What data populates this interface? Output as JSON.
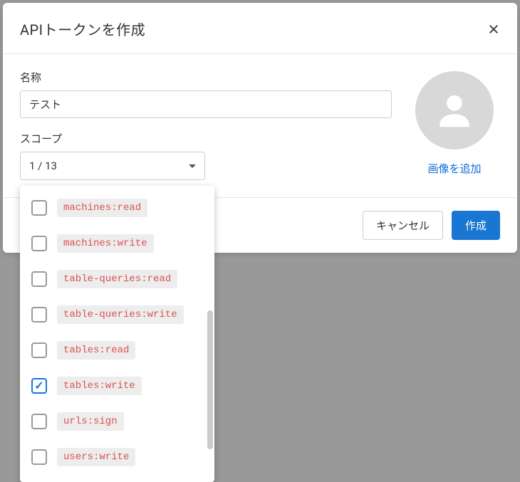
{
  "modal": {
    "title": "APIトークンを作成",
    "name_label": "名称",
    "name_value": "テスト",
    "scope_label": "スコープ",
    "scope_summary": "1 / 13",
    "add_image_label": "画像を追加",
    "cancel_label": "キャンセル",
    "create_label": "作成"
  },
  "scopes": [
    {
      "label": "machines:read",
      "checked": false
    },
    {
      "label": "machines:write",
      "checked": false
    },
    {
      "label": "table-queries:read",
      "checked": false
    },
    {
      "label": "table-queries:write",
      "checked": false
    },
    {
      "label": "tables:read",
      "checked": false
    },
    {
      "label": "tables:write",
      "checked": true
    },
    {
      "label": "urls:sign",
      "checked": false
    },
    {
      "label": "users:write",
      "checked": false
    }
  ]
}
